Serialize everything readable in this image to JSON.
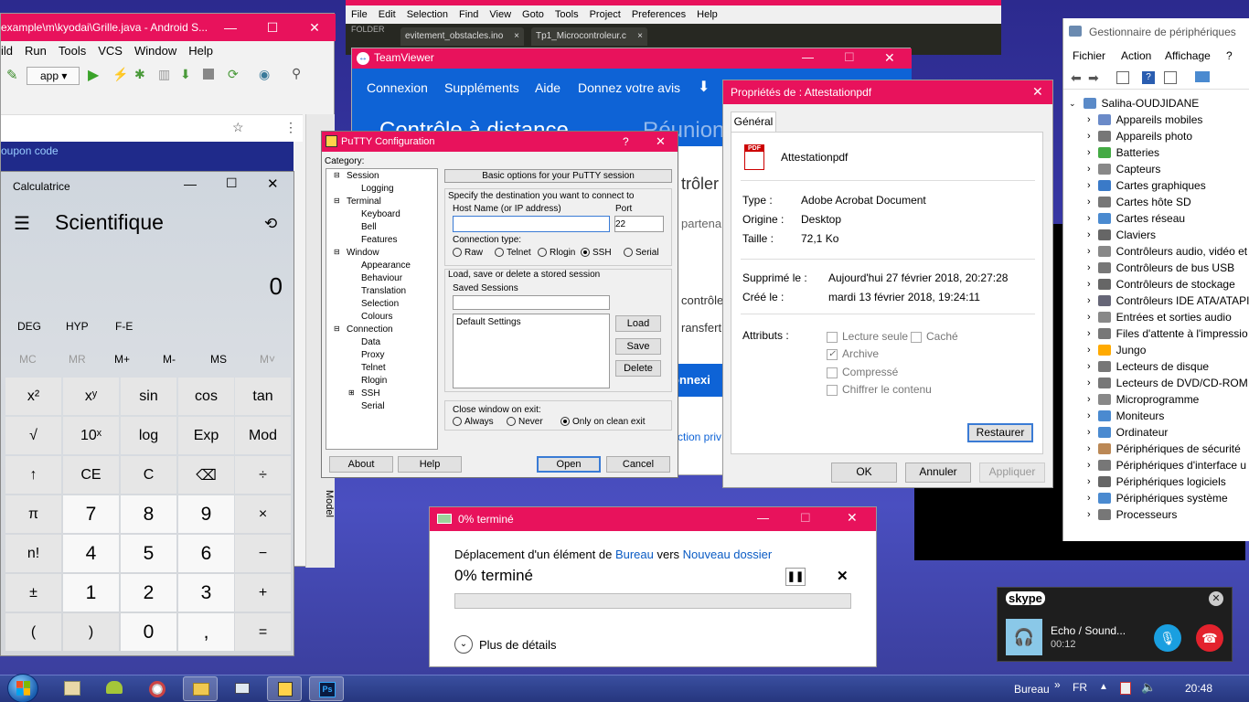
{
  "android": {
    "title": "example\\m\\kyodai\\Grille.java - Android S...",
    "menu": [
      "ild",
      "Run",
      "Tools",
      "VCS",
      "Window",
      "Help"
    ],
    "app_combo": "app",
    "browser_text": "oupon code",
    "side_label": "Model"
  },
  "sublime": {
    "menu": [
      "File",
      "Edit",
      "Selection",
      "Find",
      "View",
      "Goto",
      "Tools",
      "Project",
      "Preferences",
      "Help"
    ],
    "folder_label": "FOLDER",
    "tabs": [
      "evitement_obstacles.ino",
      "Tp1_Microcontroleur.c"
    ]
  },
  "teamviewer": {
    "title": "TeamViewer",
    "menu": [
      "Connexion",
      "Suppléments",
      "Aide",
      "Donnez votre avis"
    ],
    "banner_left": "Contrôle à distance",
    "banner_right": "Réunion",
    "frag1": "trôler",
    "frag2": "partena",
    "frag3": "contrôle",
    "frag4": "ransfert",
    "frag5": "onnexi",
    "frag6": "ction priv"
  },
  "calc": {
    "title": "Calculatrice",
    "mode": "Scientifique",
    "display": "0",
    "angle_row": [
      "DEG",
      "HYP",
      "F-E"
    ],
    "memory_row": [
      "MC",
      "MR",
      "M+",
      "M-",
      "MS",
      "M˅"
    ],
    "rows": [
      [
        "x²",
        "xʸ",
        "sin",
        "cos",
        "tan"
      ],
      [
        "√",
        "10ˣ",
        "log",
        "Exp",
        "Mod"
      ],
      [
        "↑",
        "CE",
        "C",
        "⌫",
        "÷"
      ],
      [
        "π",
        "7",
        "8",
        "9",
        "×"
      ],
      [
        "n!",
        "4",
        "5",
        "6",
        "−"
      ],
      [
        "±",
        "1",
        "2",
        "3",
        "+"
      ],
      [
        "(",
        ")",
        "0",
        ",",
        "="
      ]
    ]
  },
  "putty": {
    "title": "PuTTY Configuration",
    "category_label": "Category:",
    "tree": [
      "Session",
      "Logging",
      "Terminal",
      "Keyboard",
      "Bell",
      "Features",
      "Window",
      "Appearance",
      "Behaviour",
      "Translation",
      "Selection",
      "Colours",
      "Connection",
      "Data",
      "Proxy",
      "Telnet",
      "Rlogin",
      "SSH",
      "Serial"
    ],
    "header": "Basic options for your PuTTY session",
    "dest_label": "Specify the destination you want to connect to",
    "host_label": "Host Name (or IP address)",
    "host_value": "",
    "port_label": "Port",
    "port_value": "22",
    "conn_type_label": "Connection type:",
    "conn_types": [
      "Raw",
      "Telnet",
      "Rlogin",
      "SSH",
      "Serial"
    ],
    "sessions_group": "Load, save or delete a stored session",
    "saved_label": "Saved Sessions",
    "saved_value": "",
    "session_list": [
      "Default Settings"
    ],
    "load": "Load",
    "save": "Save",
    "delete": "Delete",
    "close_label": "Close window on exit:",
    "close_opts": [
      "Always",
      "Never",
      "Only on clean exit"
    ],
    "about": "About",
    "help": "Help",
    "open": "Open",
    "cancel": "Cancel"
  },
  "props": {
    "title": "Propriétés de : Attestationpdf",
    "tab": "Général",
    "filename": "Attestationpdf",
    "rows1": [
      [
        "Type :",
        "Adobe Acrobat Document"
      ],
      [
        "Origine :",
        "Desktop"
      ],
      [
        "Taille :",
        "72,1 Ko"
      ]
    ],
    "rows2": [
      [
        "Supprimé le :",
        "Aujourd'hui 27 février 2018, 20:27:28"
      ],
      [
        "Créé le :",
        "mardi 13 février 2018, 19:24:11"
      ]
    ],
    "attr_label": "Attributs :",
    "attrs": [
      "Lecture seule",
      "Caché",
      "Archive",
      "Compressé",
      "Chiffrer le contenu"
    ],
    "restore": "Restaurer",
    "ok": "OK",
    "cancel": "Annuler",
    "apply": "Appliquer"
  },
  "devmgr": {
    "title": "Gestionnaire de périphériques",
    "menu": [
      "Fichier",
      "Action",
      "Affichage"
    ],
    "menu_more": "?",
    "root": "Saliha-OUDJIDANE",
    "items": [
      "Appareils mobiles",
      "Appareils photo",
      "Batteries",
      "Capteurs",
      "Cartes graphiques",
      "Cartes hôte SD",
      "Cartes réseau",
      "Claviers",
      "Contrôleurs audio, vidéo et",
      "Contrôleurs de bus USB",
      "Contrôleurs de stockage",
      "Contrôleurs IDE ATA/ATAPI",
      "Entrées et sorties audio",
      "Files d'attente à l'impressio",
      "Jungo",
      "Lecteurs de disque",
      "Lecteurs de DVD/CD-ROM",
      "Microprogramme",
      "Moniteurs",
      "Ordinateur",
      "Périphériques de sécurité",
      "Périphériques d'interface u",
      "Périphériques logiciels",
      "Périphériques système",
      "Processeurs"
    ]
  },
  "copy": {
    "title": "0% terminé",
    "line_pre": "Déplacement d'un élément de ",
    "from": "Bureau",
    "mid": " vers ",
    "to": "Nouveau dossier",
    "status": "0% terminé",
    "progress": 0,
    "details": "Plus de détails"
  },
  "skype": {
    "logo": "skype",
    "caller": "Echo / Sound...",
    "time": "00:12"
  },
  "taskbar": {
    "toolbar_label": "Bureau",
    "lang": "FR",
    "clock": "20:48"
  },
  "colors": {
    "accent": "#e8125c",
    "teamviewer": "#0e63d6",
    "link": "#0a5bc4"
  }
}
